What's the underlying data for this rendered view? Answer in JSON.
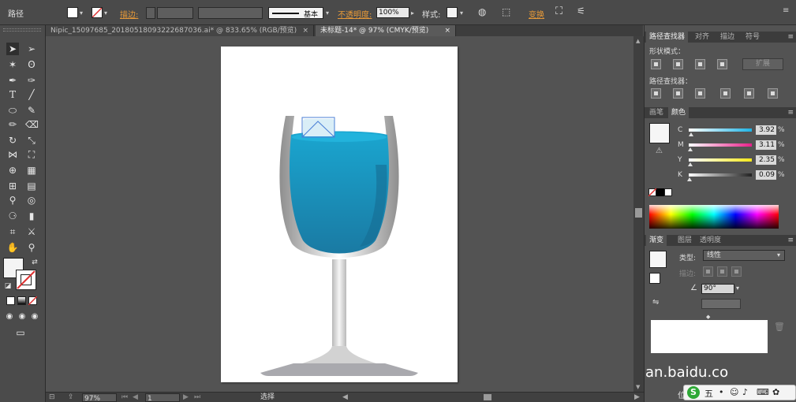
{
  "control_bar": {
    "path_label": "路径",
    "stroke_label": "描边:",
    "stroke_style": "基本",
    "opacity_label": "不透明度:",
    "opacity_value": "100%",
    "style_label": "样式:",
    "transform_label": "变换"
  },
  "tabs": [
    {
      "label": "Nipic_15097685_20180518093222687036.ai* @ 833.65% (RGB/预览)",
      "close": "×"
    },
    {
      "label": "未标题-14* @ 97% (CMYK/预览)",
      "close": "×"
    }
  ],
  "statusbar": {
    "zoom": "97%",
    "page": "1",
    "mode": "选择"
  },
  "pathfinder_panel": {
    "tabs": [
      "路径查找器",
      "对齐",
      "描边",
      "符号"
    ],
    "shape_modes_label": "形状模式：",
    "expand_button": "扩展",
    "pathfinders_label": "路径查找器："
  },
  "color_panel": {
    "tabs": [
      "画笔",
      "颜色"
    ],
    "channels": [
      {
        "name": "C",
        "value": "3.92",
        "unit": "%",
        "color": "#1fb4e6",
        "fraction": 0.04
      },
      {
        "name": "M",
        "value": "3.11",
        "unit": "%",
        "color": "#e8208a",
        "fraction": 0.03
      },
      {
        "name": "Y",
        "value": "2.35",
        "unit": "%",
        "color": "#f3e81b",
        "fraction": 0.02
      },
      {
        "name": "K",
        "value": "0.09",
        "unit": "%",
        "color": "#222222",
        "fraction": 0.01
      }
    ]
  },
  "gradient_panel": {
    "tabs": [
      "渐变",
      "图层",
      "透明度"
    ],
    "type_label": "类型:",
    "type_value": "线性",
    "stroke_label": "描边:",
    "angle_value": "90°"
  },
  "watermark": "an.baidu.co",
  "ime": {
    "logo": "S",
    "mode": "五",
    "extra": "位"
  },
  "colors": {
    "wine_top": "#1aa6d0",
    "wine_bottom": "#1a7aa3",
    "glass_stem": "#d0d0d0",
    "base": "#a9a9ae"
  }
}
